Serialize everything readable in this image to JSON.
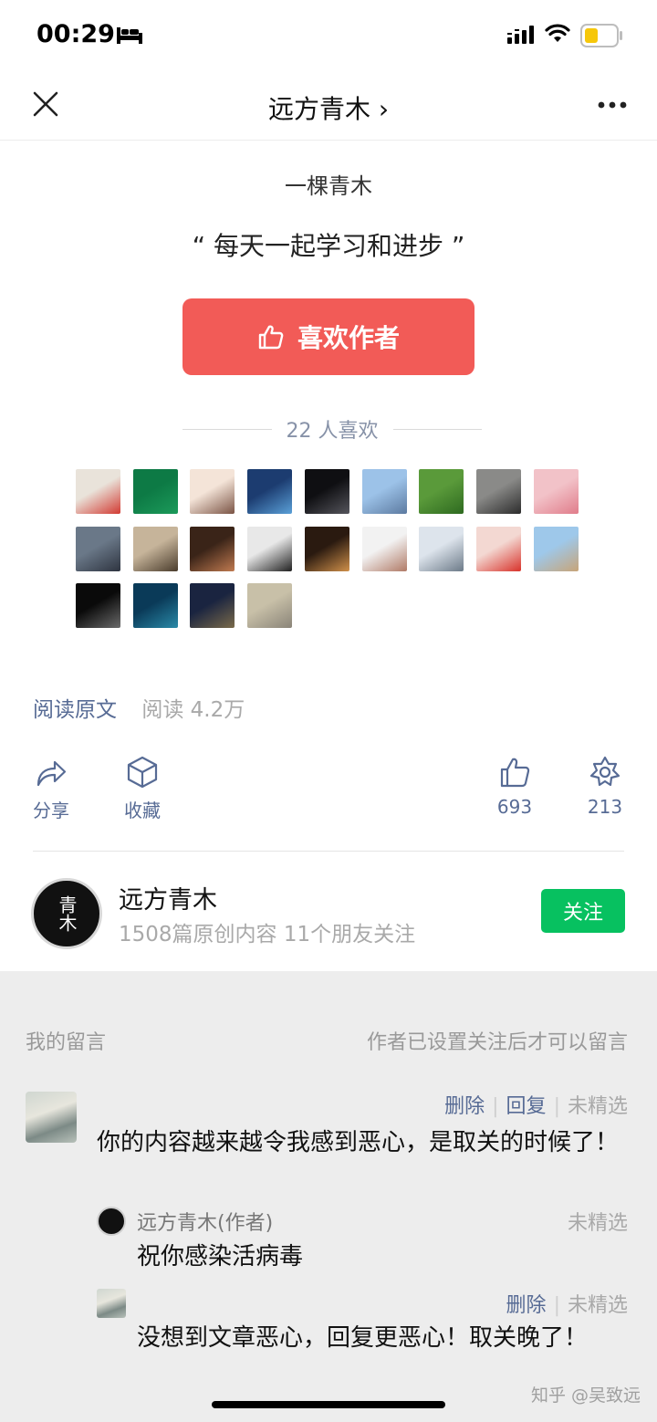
{
  "status_bar": {
    "time": "00:29"
  },
  "nav": {
    "title": "远方青木 ›"
  },
  "reward": {
    "author_sub": "一棵青木",
    "quote": "“ 每天一起学习和进步 ”",
    "like_button": "喜欢作者",
    "likes_count": "22 人喜欢"
  },
  "avatars": [
    {
      "c1": "#e9e3da",
      "c2": "#d23a32"
    },
    {
      "c1": "#0d7a45",
      "c2": "#1c9a5a"
    },
    {
      "c1": "#f4e4d8",
      "c2": "#7a5344"
    },
    {
      "c1": "#1c3c70",
      "c2": "#5aa0d8"
    },
    {
      "c1": "#0f0f12",
      "c2": "#55555c"
    },
    {
      "c1": "#9cc2e8",
      "c2": "#5c7aa0"
    },
    {
      "c1": "#5a9a3a",
      "c2": "#2e6a20"
    },
    {
      "c1": "#8a8a88",
      "c2": "#2c2c2c"
    },
    {
      "c1": "#f2c2c8",
      "c2": "#e07c8a"
    },
    {
      "c1": "#6a7888",
      "c2": "#2e3440"
    },
    {
      "c1": "#c6b49a",
      "c2": "#4a3c2c"
    },
    {
      "c1": "#3a2418",
      "c2": "#c07a50"
    },
    {
      "c1": "#e8e8e8",
      "c2": "#202020"
    },
    {
      "c1": "#2a1a10",
      "c2": "#d0904a"
    },
    {
      "c1": "#f2f2f2",
      "c2": "#b07a66"
    },
    {
      "c1": "#dde4ec",
      "c2": "#6c7a88"
    },
    {
      "c1": "#f3d8d2",
      "c2": "#d8322a"
    },
    {
      "c1": "#9ec8ea",
      "c2": "#c8a478"
    },
    {
      "c1": "#0a0a0a",
      "c2": "#6a6a6a"
    },
    {
      "c1": "#0a3a58",
      "c2": "#2a8aa8"
    },
    {
      "c1": "#1a2440",
      "c2": "#7a6a4a"
    },
    {
      "c1": "#c8c0a8",
      "c2": "#8a8478"
    }
  ],
  "article": {
    "read_original": "阅读原文",
    "read_count": "阅读 4.2万"
  },
  "actions": {
    "share": "分享",
    "collect": "收藏",
    "like_count": "693",
    "wow_count": "213"
  },
  "account": {
    "name": "远方青木",
    "meta": "1508篇原创内容  11个朋友关注",
    "avatar_text": "青木",
    "follow": "关注"
  },
  "comments": {
    "header_left": "我的留言",
    "header_right": "作者已设置关注后才可以留言",
    "delete": "删除",
    "reply": "回复",
    "not_selected": "未精选",
    "main_text": "你的内容越来越令我感到恶心，是取关的时候了！",
    "reply1_name": "远方青木(作者)",
    "reply1_text": "祝你感染活病毒",
    "reply2_text": "没想到文章恶心，回复更恶心！取关晚了！"
  },
  "watermark": "知乎 @吴致远"
}
